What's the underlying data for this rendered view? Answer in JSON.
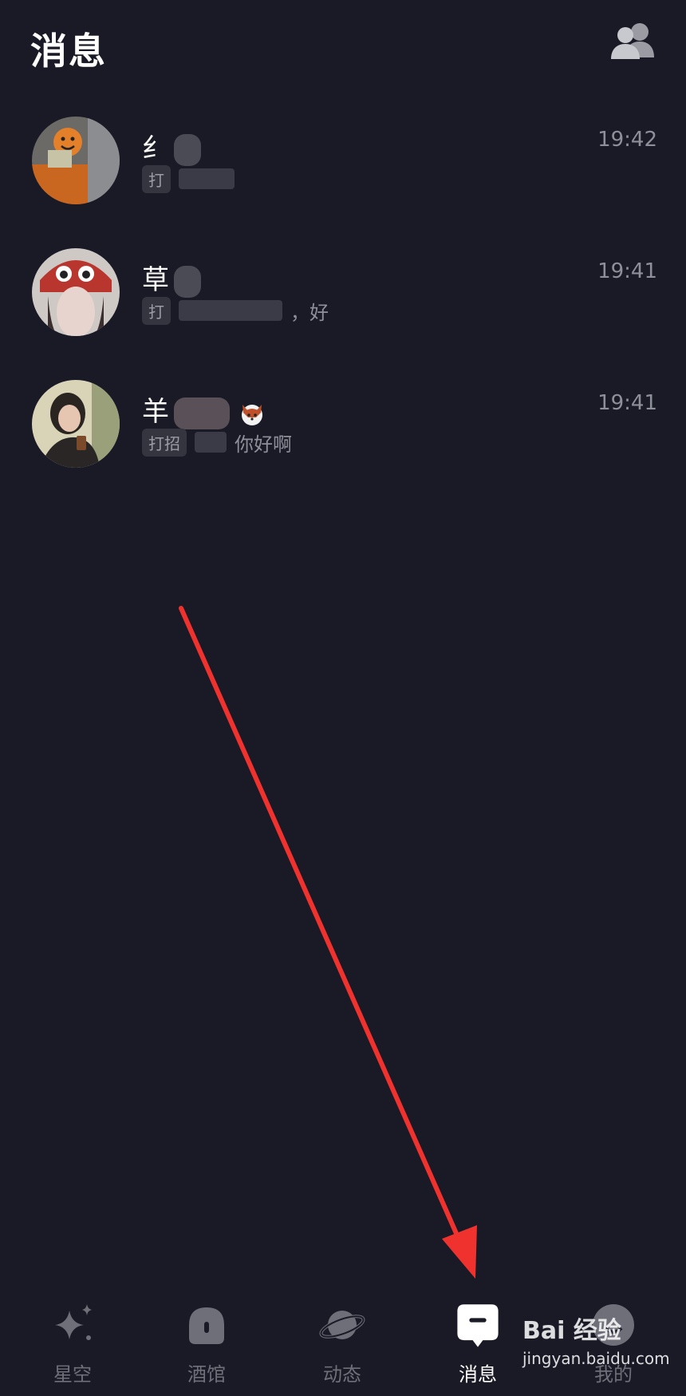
{
  "header": {
    "title": "消息",
    "contacts_icon": "people-icon"
  },
  "messages": [
    {
      "name_prefix": "纟",
      "time": "19:42",
      "preview_tag": "打",
      "preview_text": "",
      "avatar_icon": "avatar-photo"
    },
    {
      "name_prefix": "草",
      "time": "19:41",
      "preview_tag": "打",
      "preview_text": "，好",
      "avatar_icon": "avatar-photo"
    },
    {
      "name_prefix": "羊",
      "time": "19:41",
      "preview_tag": "打招",
      "preview_text": "你好啊",
      "avatar_icon": "avatar-photo"
    }
  ],
  "tabbar": {
    "tabs": [
      {
        "label": "星空",
        "icon": "sparkle-icon"
      },
      {
        "label": "酒馆",
        "icon": "bubble-icon"
      },
      {
        "label": "动态",
        "icon": "planet-icon"
      },
      {
        "label": "消息",
        "icon": "message-icon"
      },
      {
        "label": "我的",
        "icon": "profile-icon"
      }
    ],
    "active_index": 3
  },
  "watermark": {
    "brand": "Bai 经验",
    "url": "jingyan.baidu.com"
  },
  "colors": {
    "background": "#191a26",
    "annotation_arrow": "#f0322f"
  }
}
